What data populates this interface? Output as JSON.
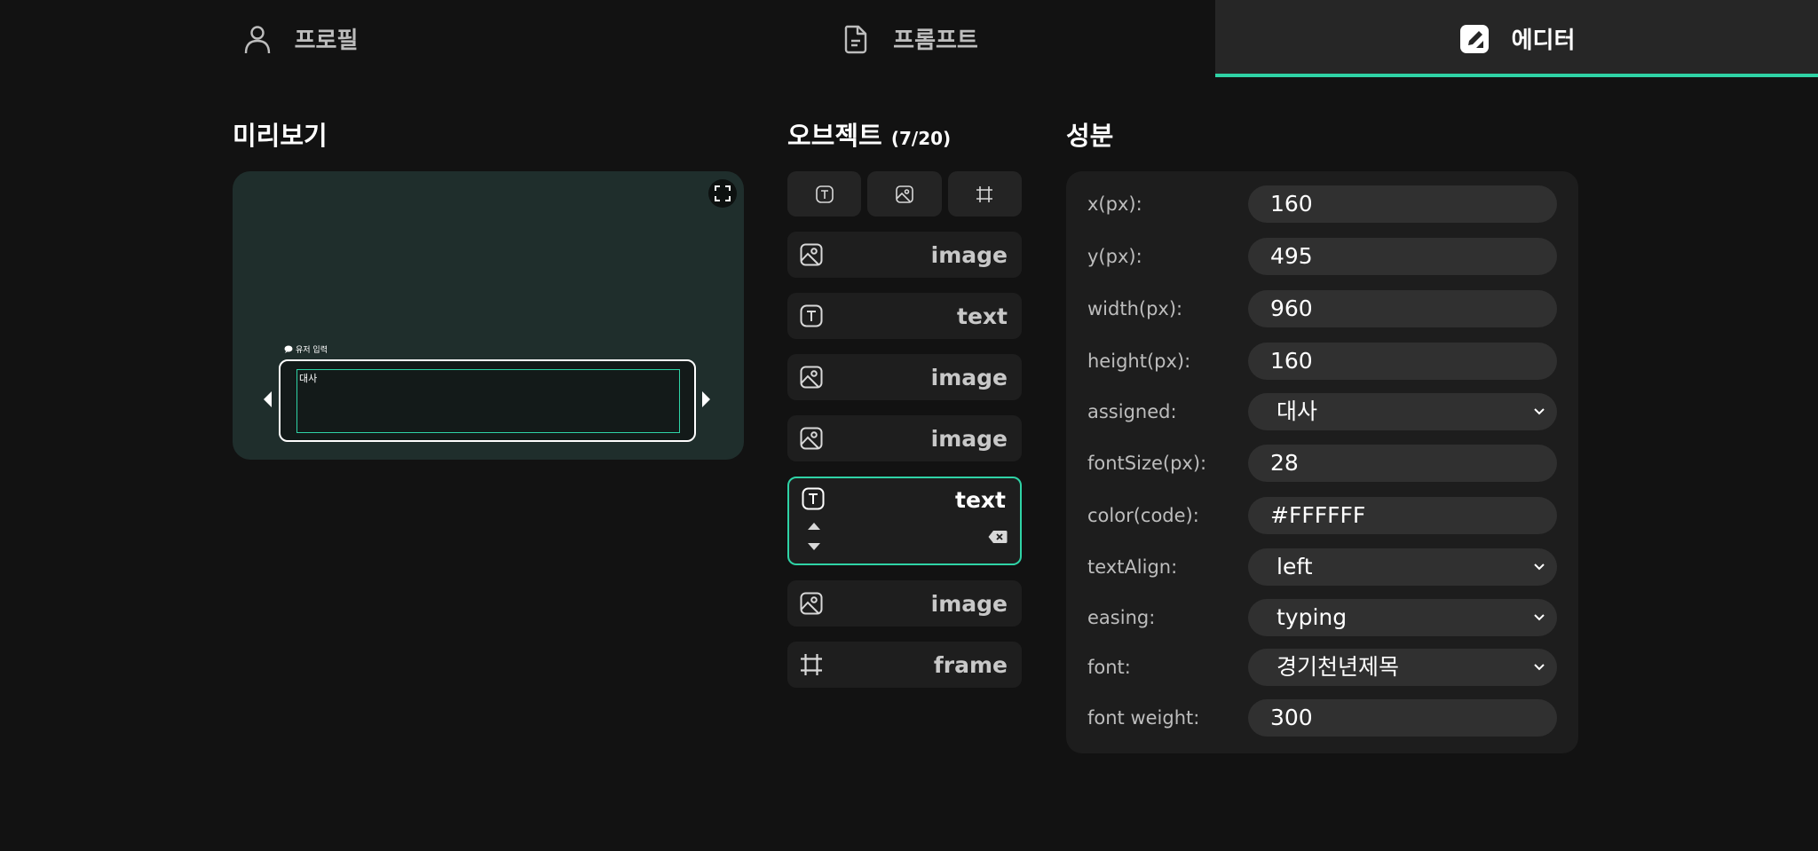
{
  "tabs": {
    "profile": "프로필",
    "prompt": "프롬프트",
    "editor": "에디터"
  },
  "accent_color": "#2fd3a6",
  "preview": {
    "title": "미리보기",
    "user_input_label": "유저 입력",
    "dialog_text": "대사"
  },
  "objects": {
    "title": "오브젝트",
    "count": "(7/20)",
    "items": [
      {
        "type": "image",
        "label": "image"
      },
      {
        "type": "text",
        "label": "text"
      },
      {
        "type": "image",
        "label": "image"
      },
      {
        "type": "image",
        "label": "image"
      },
      {
        "type": "text",
        "label": "text",
        "selected": true
      },
      {
        "type": "image",
        "label": "image"
      },
      {
        "type": "frame",
        "label": "frame"
      }
    ]
  },
  "properties": {
    "title": "성분",
    "rows": [
      {
        "label": "x(px):",
        "value": "160",
        "kind": "input"
      },
      {
        "label": "y(px):",
        "value": "495",
        "kind": "input"
      },
      {
        "label": "width(px):",
        "value": "960",
        "kind": "input"
      },
      {
        "label": "height(px):",
        "value": "160",
        "kind": "input"
      },
      {
        "label": "assigned:",
        "value": "대사",
        "kind": "select"
      },
      {
        "label": "fontSize(px):",
        "value": "28",
        "kind": "input"
      },
      {
        "label": "color(code):",
        "value": "#FFFFFF",
        "kind": "input"
      },
      {
        "label": "textAlign:",
        "value": "left",
        "kind": "select"
      },
      {
        "label": "easing:",
        "value": "typing",
        "kind": "select"
      },
      {
        "label": "font:",
        "value": "경기천년제목",
        "kind": "select"
      },
      {
        "label": "font weight:",
        "value": "300",
        "kind": "input"
      }
    ]
  }
}
